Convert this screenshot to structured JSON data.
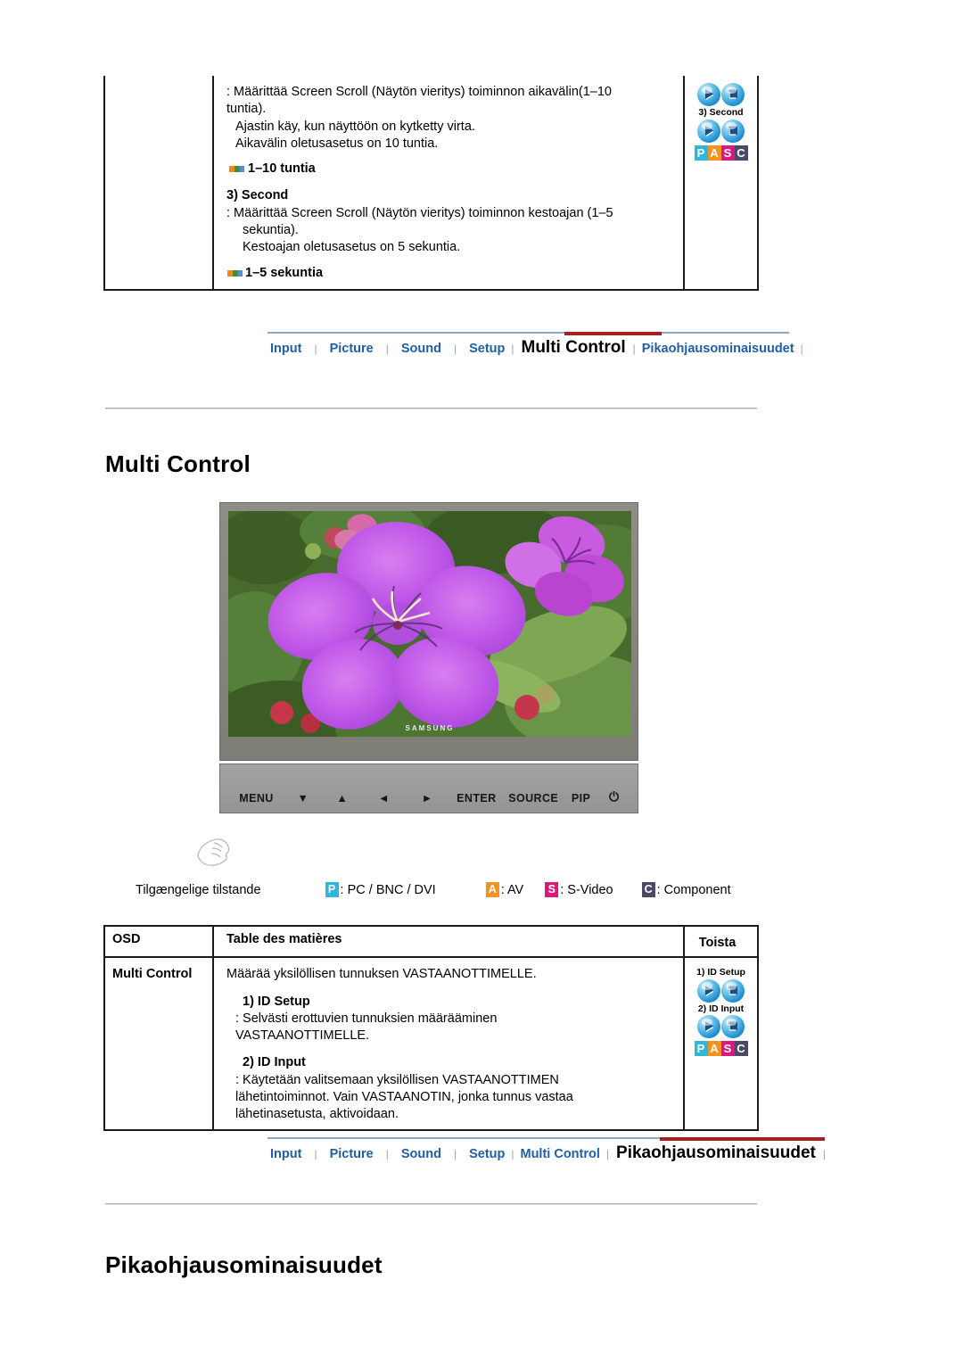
{
  "top_section": {
    "body": {
      "line1": ": Määrittää Screen Scroll (Näytön vieritys) toiminnon aikavälin(1–10",
      "line2": "tuntia).",
      "line3": "Ajastin käy, kun näyttöön on kytketty virta.",
      "line4": "Aikavälin oletusasetus on 10 tuntia.",
      "bullet1": "1–10 tuntia",
      "subhead": "3) Second",
      "line5": ":  Määrittää Screen Scroll (Näytön vieritys) toiminnon kestoajan (1–5",
      "line6": "sekuntia).",
      "line7": "Kestoajan oletusasetus on 5 sekuntia.",
      "bullet2": "1–5 sekuntia"
    },
    "icons": {
      "caption": "3) Second",
      "pasc": [
        "P",
        "A",
        "S",
        "C"
      ]
    }
  },
  "nav_top": {
    "items": [
      {
        "label": "Input",
        "active": false
      },
      {
        "label": "Picture",
        "active": false
      },
      {
        "label": "Sound",
        "active": false
      },
      {
        "label": "Setup",
        "active": false
      },
      {
        "label": "Multi Control",
        "active": true
      },
      {
        "label": "Pikaohjausominaisuudet",
        "active": false
      }
    ],
    "separator": "|"
  },
  "nav_bottom": {
    "items": [
      {
        "label": "Input",
        "active": false
      },
      {
        "label": "Picture",
        "active": false
      },
      {
        "label": "Sound",
        "active": false
      },
      {
        "label": "Setup",
        "active": false
      },
      {
        "label": "Multi Control",
        "active": false
      },
      {
        "label": "Pikaohjausominaisuudet",
        "active": true
      }
    ],
    "separator": "|"
  },
  "headings": {
    "multi_control": "Multi Control",
    "quick_setup": "Pikaohjausominaisuudet"
  },
  "monitor": {
    "brand": "SAMSUNG",
    "controls": [
      "MENU",
      "▼",
      "▲",
      "◄",
      "►",
      "ENTER",
      "SOURCE",
      "PIP",
      "⏻"
    ]
  },
  "modes_legend": {
    "label": "Tilgængelige tilstande",
    "entries": [
      {
        "badge": "P",
        "text": ": PC / BNC / DVI",
        "color": "#2fb6db"
      },
      {
        "badge": "A",
        "text": ": AV",
        "color": "#f59320"
      },
      {
        "badge": "S",
        "text": ": S-Video",
        "color": "#d9197f"
      },
      {
        "badge": "C",
        "text": ": Component",
        "color": "#4a4a66"
      }
    ]
  },
  "osd_table": {
    "headers": {
      "osd": "OSD",
      "toc": "Table des matières",
      "replay": "Toista"
    },
    "row": {
      "osd": "Multi Control",
      "intro": "Määrää yksilöllisen tunnuksen VASTAANOTTIMELLE.",
      "item1_head": "1) ID Setup",
      "item1_line1": ": Selvästi erottuvien tunnuksien määrääminen",
      "item1_line2": "VASTAANOTTIMELLE.",
      "item2_head": "2) ID Input",
      "item2_line1": ": Käytetään valitsemaan yksilöllisen VASTAANOTTIMEN",
      "item2_line2": "lähetintoiminnot. Vain VASTAANOTIN, jonka tunnus vastaa",
      "item2_line3": "lähetinasetusta, aktivoidaan.",
      "icon1_caption": "1) ID Setup",
      "icon2_caption": "2) ID Input",
      "pasc": [
        "P",
        "A",
        "S",
        "C"
      ]
    }
  },
  "colors": {
    "nav_link": "#1f5fa9",
    "nav_active_underline": "#a81f21",
    "rule": "#a9a9a9"
  }
}
